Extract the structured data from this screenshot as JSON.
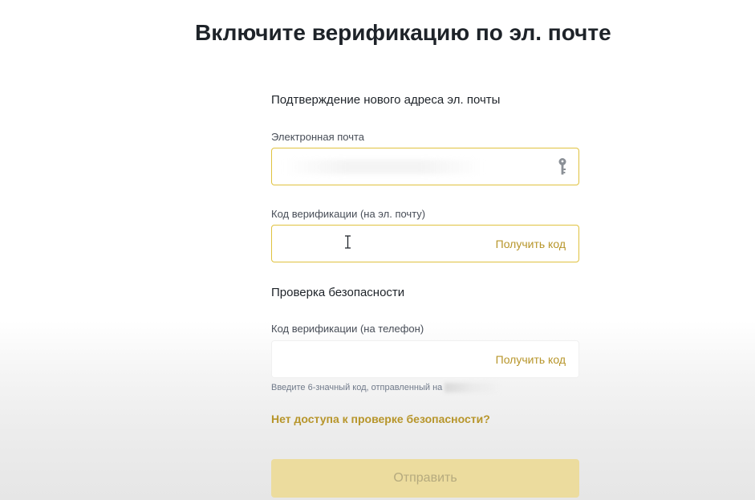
{
  "page": {
    "title": "Включите верификацию по эл. почте"
  },
  "email_section": {
    "heading": "Подтверждение нового адреса эл. почты",
    "email_field": {
      "label": "Электронная почта",
      "value": "",
      "icon": "key-icon"
    },
    "email_code_field": {
      "label": "Код верификации (на эл. почту)",
      "value": "",
      "action_label": "Получить код"
    }
  },
  "security_section": {
    "heading": "Проверка безопасности",
    "phone_code_field": {
      "label": "Код верификации (на телефон)",
      "value": "",
      "action_label": "Получить код",
      "hint": "Введите 6-значный код, отправленный на"
    },
    "help_link": "Нет доступа к проверке безопасности?"
  },
  "submit": {
    "label": "Отправить",
    "disabled": true
  },
  "colors": {
    "accent": "#b7952a",
    "focus_border": "#e0c23f",
    "button_disabled_bg": "#ecdc9e",
    "button_disabled_text": "#b5aa7e",
    "text_primary": "#1e2329",
    "text_secondary": "#474d57"
  }
}
